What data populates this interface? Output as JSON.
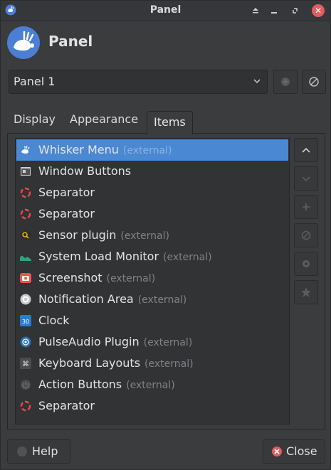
{
  "window": {
    "title": "Panel"
  },
  "header": {
    "title": "Panel"
  },
  "panel_select": {
    "selected": "Panel 1"
  },
  "tabs": [
    {
      "label": "Display",
      "active": false
    },
    {
      "label": "Appearance",
      "active": false
    },
    {
      "label": "Items",
      "active": true
    }
  ],
  "items": [
    {
      "name": "Whisker Menu",
      "suffix": "(external)",
      "icon": "whisker-menu-icon",
      "selected": true
    },
    {
      "name": "Window Buttons",
      "suffix": "",
      "icon": "window-buttons-icon"
    },
    {
      "name": "Separator",
      "suffix": "",
      "icon": "separator-icon"
    },
    {
      "name": "Separator",
      "suffix": "",
      "icon": "separator-icon"
    },
    {
      "name": "Sensor plugin",
      "suffix": "(external)",
      "icon": "sensor-icon"
    },
    {
      "name": "System Load Monitor",
      "suffix": "(external)",
      "icon": "system-load-icon"
    },
    {
      "name": "Screenshot",
      "suffix": "(external)",
      "icon": "screenshot-icon"
    },
    {
      "name": "Notification Area",
      "suffix": "(external)",
      "icon": "notification-area-icon"
    },
    {
      "name": "Clock",
      "suffix": "",
      "icon": "clock-icon",
      "icon_text": "30"
    },
    {
      "name": "PulseAudio Plugin",
      "suffix": "(external)",
      "icon": "pulseaudio-icon"
    },
    {
      "name": "Keyboard Layouts",
      "suffix": "(external)",
      "icon": "keyboard-icon",
      "icon_text": "⌘"
    },
    {
      "name": "Action Buttons",
      "suffix": "(external)",
      "icon": "action-buttons-icon"
    },
    {
      "name": "Separator",
      "suffix": "",
      "icon": "separator-icon"
    }
  ],
  "buttons": {
    "help": "Help",
    "close": "Close"
  },
  "colors": {
    "selection": "#4a88d3",
    "close_red": "#e35d5d",
    "accent_blue": "#4a7fd4"
  }
}
